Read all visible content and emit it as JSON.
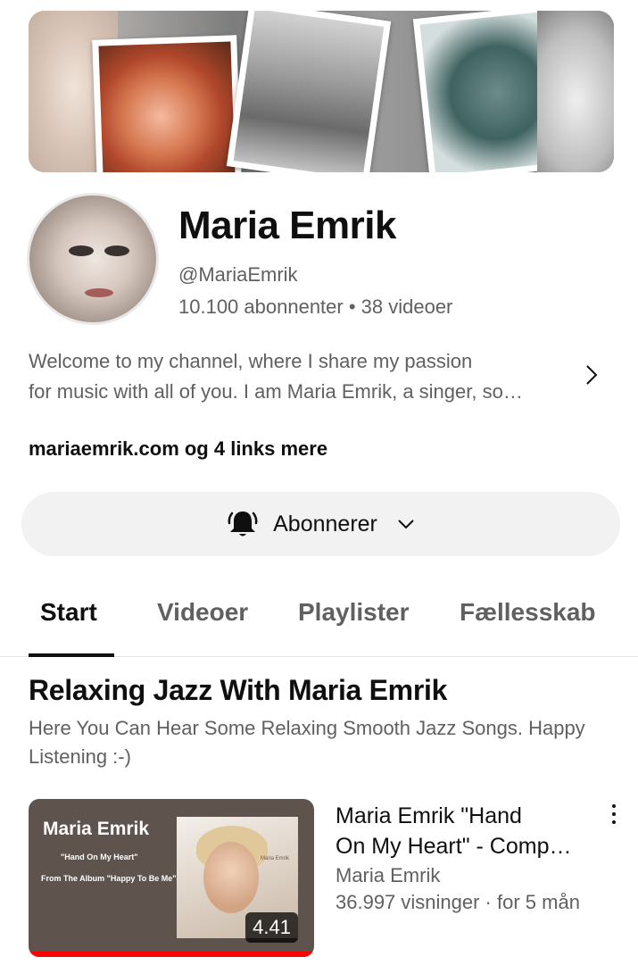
{
  "channel": {
    "name": "Maria Emrik",
    "handle": "@MariaEmrik",
    "stats": "10.100 abonnenter • 38 videoer",
    "description_line1": "Welcome to my channel, where I share my passion",
    "description_line2": "for music with all of you. I am Maria Emrik, a singer, so…",
    "links": "mariaemrik.com og 4 links mere"
  },
  "subscribe": {
    "label": "Abonnerer"
  },
  "tabs": [
    {
      "label": "Start",
      "active": true
    },
    {
      "label": "Videoer",
      "active": false
    },
    {
      "label": "Playlister",
      "active": false
    },
    {
      "label": "Fællesskab",
      "active": false
    }
  ],
  "section": {
    "title": "Relaxing Jazz With Maria Emrik",
    "description": "Here You Can Hear Some Relaxing Smooth Jazz Songs. Happy Listening :-)"
  },
  "video": {
    "thumb_title": "Maria Emrik",
    "thumb_sub1": "\"Hand On My Heart\"",
    "thumb_sub2": "From The Album \"Happy To Be Me\"",
    "thumb_art_text": "Maria Emrik",
    "duration": "4.41",
    "progress_fraction": 1.0,
    "title_line1": "Maria Emrik \"Hand",
    "title_line2": "On My Heart\" - Comp…",
    "channel": "Maria Emrik",
    "meta": "36.997 visninger · for 5 mån"
  },
  "colors": {
    "progress": "#ff0000",
    "subscribe_bg": "#f2f2f2",
    "secondary_text": "#606060"
  }
}
